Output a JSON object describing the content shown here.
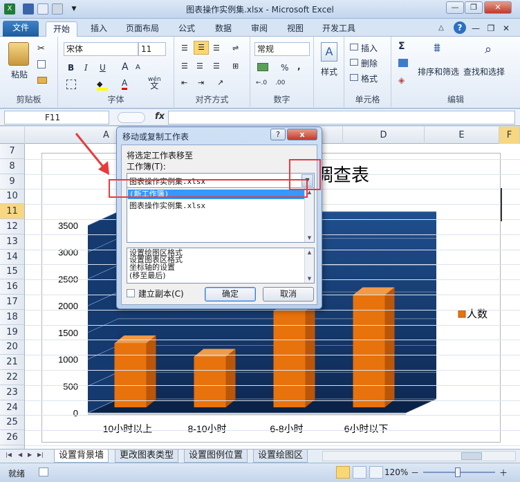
{
  "window": {
    "title": "图表操作实例集.xlsx - Microsoft Excel",
    "help": "?"
  },
  "tabs": {
    "file": "文件",
    "items": [
      "开始",
      "插入",
      "页面布局",
      "公式",
      "数据",
      "审阅",
      "视图",
      "开发工具"
    ],
    "active": "开始"
  },
  "ribbon": {
    "clipboard": {
      "label": "剪贴板",
      "paste": "粘贴"
    },
    "font": {
      "label": "字体",
      "name": "宋体",
      "size": "11",
      "bold": "B",
      "italic": "I",
      "underline": "U",
      "big_a": "A",
      "small_a": "A",
      "wen": "wén",
      "wen_char": "文"
    },
    "alignment": {
      "label": "对齐方式"
    },
    "number": {
      "label": "数字",
      "format": "常规",
      "percent": "%",
      "comma": ",",
      "inc": "←.0",
      "dec": ".00"
    },
    "styles": {
      "label": "样式",
      "button": "样式"
    },
    "cells": {
      "label": "单元格",
      "insert": "插入",
      "delete": "删除",
      "format": "格式"
    },
    "editing": {
      "label": "编辑",
      "sum": "Σ",
      "sort": "排序和筛选",
      "find": "查找和选择"
    }
  },
  "formula_bar": {
    "name_box": "F11",
    "fx": "fx",
    "value": ""
  },
  "grid": {
    "columns": [
      "A",
      "C",
      "D",
      "E",
      "F"
    ],
    "rows": [
      "7",
      "8",
      "9",
      "10",
      "11",
      "12",
      "13",
      "14",
      "15",
      "16",
      "17",
      "18",
      "19",
      "20",
      "21",
      "22",
      "23",
      "24",
      "25",
      "26"
    ],
    "selected_row": "11",
    "selected_col": "F"
  },
  "chart_data": {
    "type": "bar",
    "title": "调查表",
    "categories": [
      "10小时以上",
      "8-10小时",
      "6-8小时",
      "6小时以下"
    ],
    "series": [
      {
        "name": "人数",
        "values": [
          1300,
          1050,
          1900,
          2200
        ]
      }
    ],
    "ylim": [
      0,
      3500
    ],
    "yticks": [
      "0",
      "500",
      "1000",
      "1500",
      "2000",
      "2500",
      "3000",
      "3500"
    ],
    "grid": true,
    "legend": "right",
    "colors": {
      "bar": "#e8720c",
      "bar_side": "#b9560a",
      "bar_top": "#f29a45",
      "background": "#0f2a55"
    }
  },
  "dialog": {
    "title": "移动或复制工作表",
    "help": "?",
    "close": "x",
    "move_to_label": "将选定工作表移至",
    "workbook_label": "工作簿(T):",
    "workbook_value": "图表操作实例集.xlsx",
    "workbook_options": [
      "(新工作簿)",
      "图表操作实例集.xlsx"
    ],
    "sheets": [
      "设置绘图区格式",
      "设置图表区格式",
      "坐标轴的设置",
      "(移至最后)"
    ],
    "copy_label": "建立副本(C)",
    "ok": "确定",
    "cancel": "取消"
  },
  "sheet_tabs": [
    "设置背景墙",
    "更改图表类型",
    "设置图例位置",
    "设置绘图区"
  ],
  "status": {
    "ready": "就绪",
    "zoom": "120%",
    "minus": "－",
    "plus": "＋"
  }
}
